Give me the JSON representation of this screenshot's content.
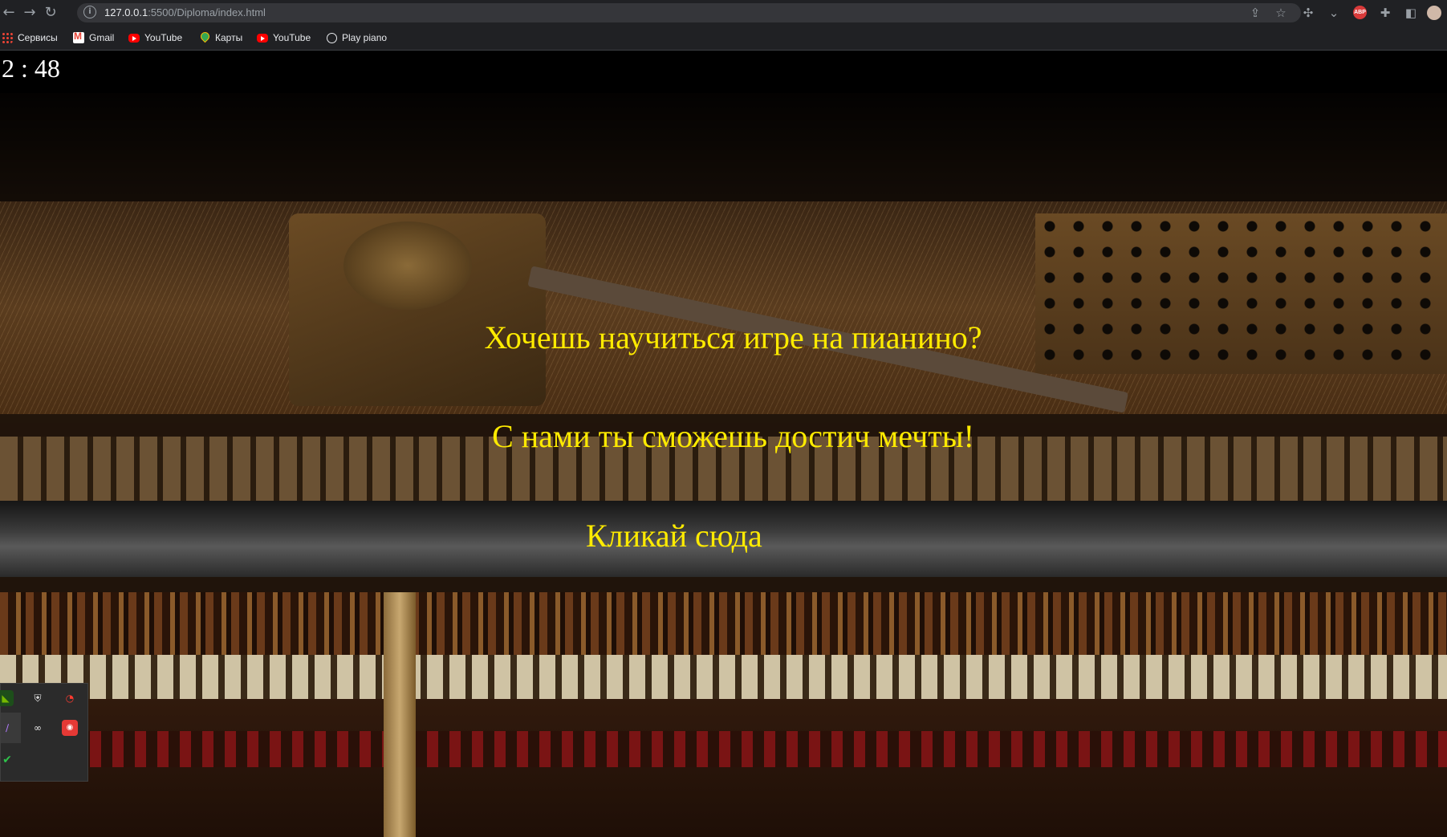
{
  "browser": {
    "url_host": "127.0.0.1",
    "url_path": ":5500/Diploma/index.html",
    "bookmarks": [
      {
        "label": "Сервисы",
        "icon": "apps-grid-icon"
      },
      {
        "label": "Gmail",
        "icon": "gmail-icon"
      },
      {
        "label": "YouTube",
        "icon": "youtube-icon"
      },
      {
        "label": "Карты",
        "icon": "maps-icon"
      },
      {
        "label": "YouTube",
        "icon": "youtube-icon"
      },
      {
        "label": "Play piano",
        "icon": "globe-icon"
      }
    ],
    "extension_badge": "ABP"
  },
  "page": {
    "clock": "2 : 48",
    "headline": "Хочешь научиться игре на пианино?",
    "subline": "С нами ты сможешь достич мечты!",
    "cta_label": "Кликай сюда",
    "text_color": "#ffeb00"
  },
  "tray": {
    "icons": [
      "nvidia-icon",
      "shield-icon",
      "speedometer-icon",
      "feather-icon",
      "link-icon",
      "record-icon",
      "check-icon"
    ]
  }
}
